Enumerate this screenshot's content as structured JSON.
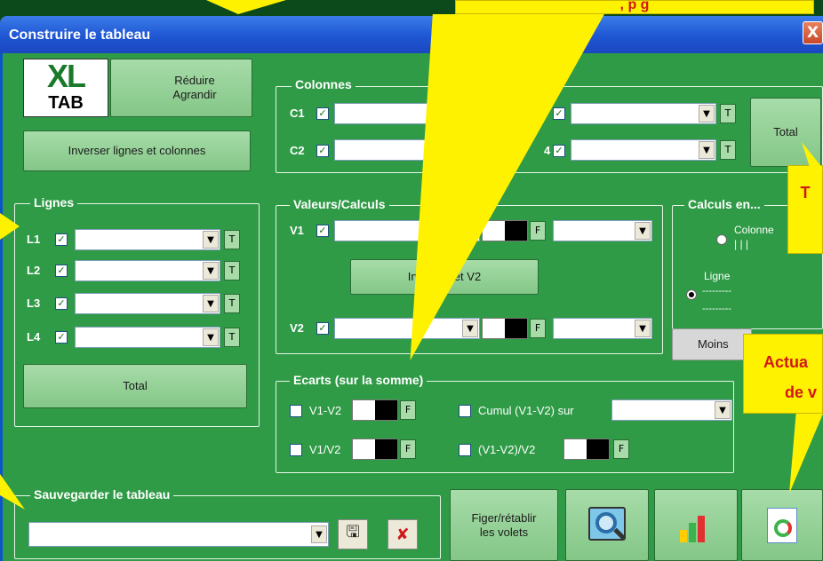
{
  "window": {
    "title": "Construire le tableau",
    "close_glyph": "X"
  },
  "logo": {
    "line1": "XL",
    "line2": "TAB"
  },
  "top_buttons": {
    "reduce_enlarge": "Réduire\nAgrandir",
    "swap_rows_cols": "Inverser lignes et colonnes"
  },
  "colonnes": {
    "legend": "Colonnes",
    "c1": "C1",
    "c2": "C2",
    "c4": "4",
    "t": "T",
    "total": "Total"
  },
  "lignes": {
    "legend": "Lignes",
    "rows": [
      "L1",
      "L2",
      "L3",
      "L4"
    ],
    "t": "T",
    "total": "Total"
  },
  "valeurs": {
    "legend": "Valeurs/Calculs",
    "v1": "V1",
    "v2": "V2",
    "f": "F",
    "swap_label": "Inver  V1 et V2"
  },
  "calculs_en": {
    "legend": "Calculs en...",
    "colonne": "Colonne",
    "ligne": "Ligne",
    "dashes": "---------",
    "ticks": "|  |  |",
    "moins_btn": "Moins"
  },
  "ecarts": {
    "legend": "Ecarts (sur la somme)",
    "diff": "V1-V2",
    "ratio": "V1/V2",
    "cumul": "Cumul (V1-V2) sur",
    "pct": "(V1-V2)/V2",
    "f": "F"
  },
  "sauvegarder": {
    "legend": "Sauvegarder le tableau",
    "save_icon": "floppy-disk-icon",
    "delete_icon": "delete-x-icon",
    "delete_glyph": "✘",
    "save_glyph": "🖫"
  },
  "bottom": {
    "freeze_label": "Figer/rétablir\nles volets"
  },
  "callouts": {
    "top_center": ", p                 g",
    "right_mid": "T",
    "actua_line1": "Actua",
    "actua_line2": "de v"
  },
  "colors": {
    "panel": "#2f9b46",
    "titlebar": "#1f56d3",
    "callout": "#fff200",
    "callout_text": "#d01818"
  }
}
